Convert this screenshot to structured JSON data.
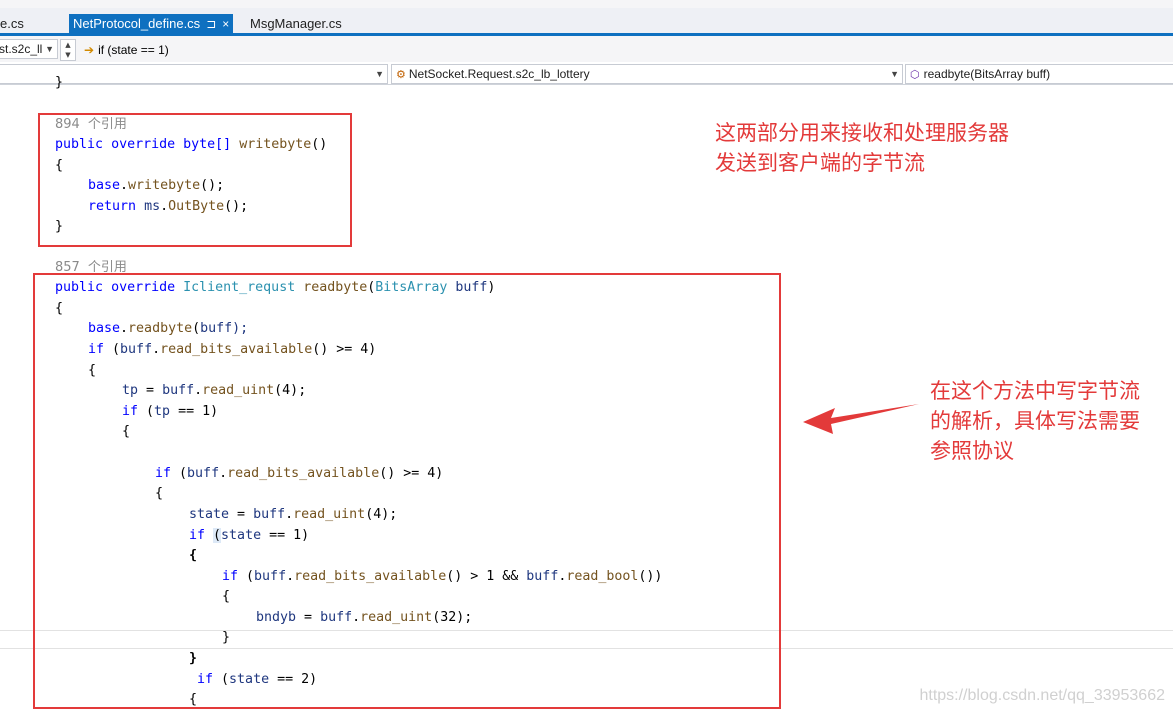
{
  "tabs": [
    {
      "label": "e.cs",
      "active": false
    },
    {
      "label": "NetProtocol_define.cs",
      "active": true,
      "pin": "⊐",
      "close": "×"
    },
    {
      "label": "MsgManager.cs",
      "active": false
    }
  ],
  "nav": {
    "member_dropdown": "st.s2c_ll",
    "statement": "if (state == 1)",
    "class_dropdown": "NetSocket.Request.s2c_lb_lottery",
    "method_dropdown": "readbyte(BitsArray buff)"
  },
  "code": {
    "brace_top": "}",
    "ref1_count": "894",
    "ref_label": "个引用",
    "w_public": "public",
    "w_override": "override",
    "w_byte_arr": "byte[]",
    "w_writebyte": "writebyte",
    "w_parens": "()",
    "w_open_brace": "{",
    "w_close_brace": "}",
    "w_base": "base",
    "w_dot": ".",
    "w_call_end": "();",
    "w_return": "return",
    "w_ms": "ms",
    "w_outbyte": "OutByte",
    "ref2_count": "857",
    "w_iclient": "Iclient_requst",
    "w_readbyte": "readbyte",
    "w_lparen": "(",
    "w_bitsarray": "BitsArray",
    "w_buff": "buff",
    "w_rparen": ")",
    "w_buff_end": "buff);",
    "w_if": "if",
    "w_read_bits": "read_bits_available",
    "w_ge4": ">= 4)",
    "w_tp": "tp",
    "w_eq": "=",
    "w_read_uint": "read_uint",
    "w_arg4": "(4);",
    "w_eq1": "== 1)",
    "w_state": "state",
    "w_gt1": "> 1 &&",
    "w_read_bool": "read_bool",
    "w_close2": "())",
    "w_bndyb": "bndyb",
    "w_arg32": "(32);",
    "w_eq2": "== 2)"
  },
  "annotations": {
    "note1_line1": "这两部分用来接收和处理服务器",
    "note1_line2": "发送到客户端的字节流",
    "note2_line1": "在这个方法中写字节流",
    "note2_line2": "的解析，具体写法需要",
    "note2_line3": "参照协议"
  },
  "watermark": "https://blog.csdn.net/qq_33953662",
  "colors": {
    "accent": "#0e70c0",
    "annotation": "#e33a3a",
    "keyword": "#0000ff",
    "type": "#2b91af"
  }
}
